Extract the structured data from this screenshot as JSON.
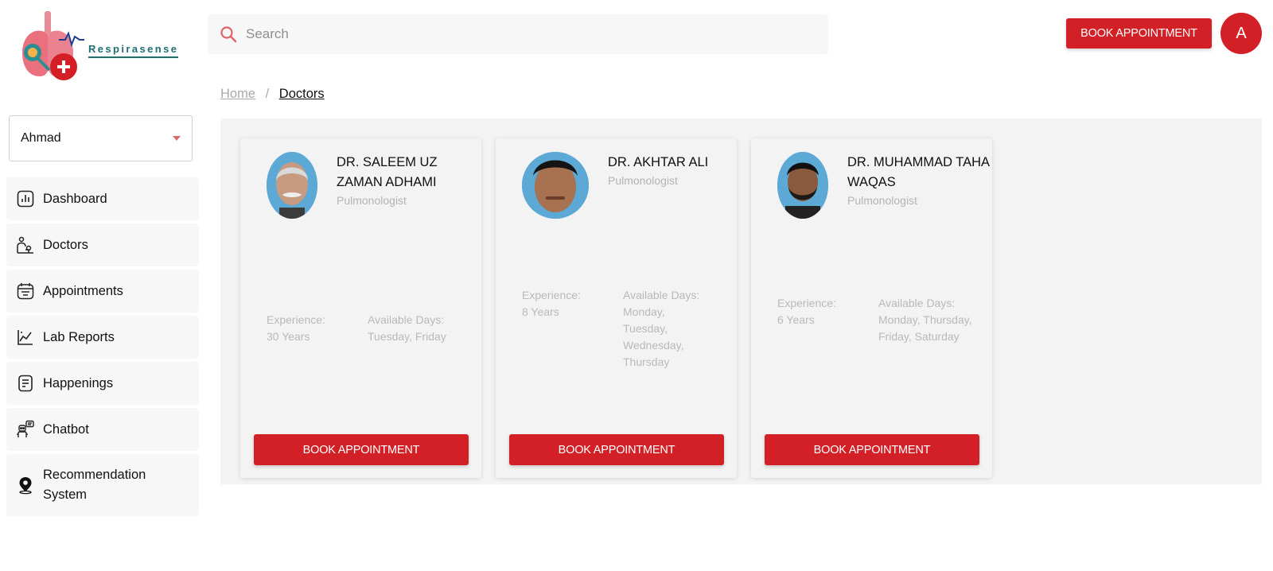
{
  "app": {
    "logo_text": "Respirasense"
  },
  "search": {
    "placeholder": "Search"
  },
  "header": {
    "book_label": "BOOK APPOINTMENT",
    "avatar_initial": "A"
  },
  "user_select": {
    "value": "Ahmad"
  },
  "sidebar": {
    "items": [
      {
        "label": "Dashboard",
        "icon": "bar-chart-icon"
      },
      {
        "label": "Doctors",
        "icon": "doctor-icon"
      },
      {
        "label": "Appointments",
        "icon": "calendar-icon"
      },
      {
        "label": "Lab Reports",
        "icon": "line-chart-icon"
      },
      {
        "label": "Happenings",
        "icon": "document-icon"
      },
      {
        "label": "Chatbot",
        "icon": "chatbot-icon"
      },
      {
        "label": "Recommendation System",
        "icon": "location-pin-icon"
      }
    ]
  },
  "breadcrumb": {
    "home": "Home",
    "separator": "/",
    "current": "Doctors"
  },
  "doctors": [
    {
      "name": "DR. SALEEM UZ ZAMAN ADHAMI",
      "specialty": "Pulmonologist",
      "experience_label": "Experience:",
      "experience": "30 Years",
      "days_label": "Available Days:",
      "days": "Tuesday, Friday",
      "book_label": "BOOK APPOINTMENT"
    },
    {
      "name": "DR. AKHTAR ALI",
      "specialty": "Pulmonologist",
      "experience_label": "Experience:",
      "experience": "8 Years",
      "days_label": "Available Days:",
      "days": "Monday, Tuesday, Wednesday, Thursday",
      "book_label": "BOOK APPOINTMENT"
    },
    {
      "name": "DR. MUHAMMAD TAHA WAQAS",
      "specialty": "Pulmonologist",
      "experience_label": "Experience:",
      "experience": "6 Years",
      "days_label": "Available Days:",
      "days": "Monday, Thursday, Friday, Saturday",
      "book_label": "BOOK APPOINTMENT"
    }
  ],
  "colors": {
    "accent": "#d32027",
    "logo_teal": "#1d6f74",
    "panel_bg": "#f3f3f3",
    "muted_text": "#b3b3b3"
  }
}
